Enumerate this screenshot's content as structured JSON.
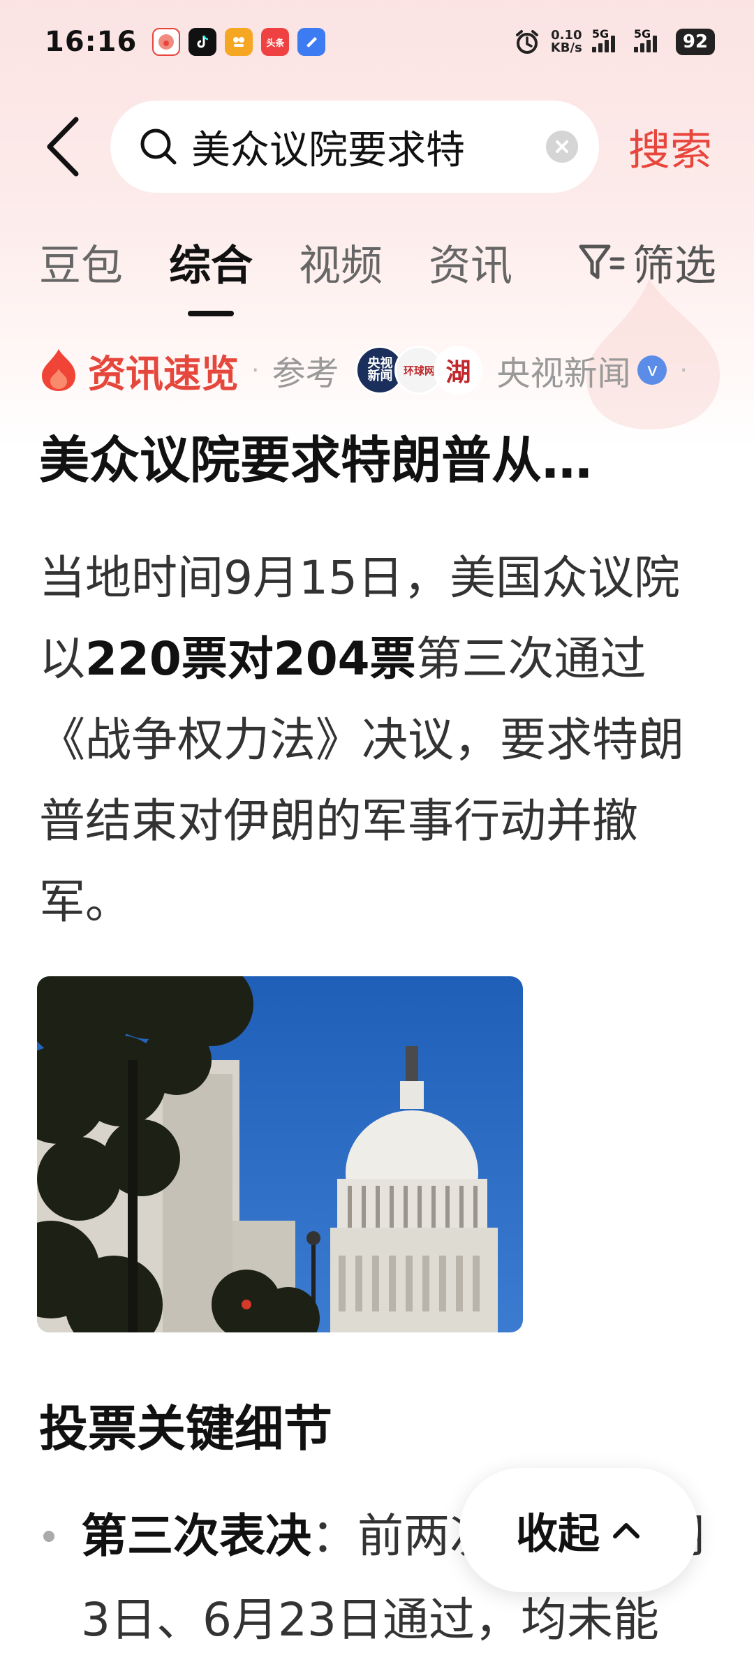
{
  "status_bar": {
    "time": "16:16",
    "net_speed_value": "0.10",
    "net_speed_unit": "KB/s",
    "signal_1": "5G",
    "signal_2": "5G",
    "battery": "92",
    "app_icons": [
      "clown-app-icon",
      "douyin-icon",
      "app-icon-orange",
      "toutiao-icon",
      "blue-app-icon"
    ],
    "toutiao_label": "头条"
  },
  "search": {
    "query": "美众议院要求特",
    "submit_label": "搜索"
  },
  "tabs": [
    {
      "label": "豆包",
      "active": false
    },
    {
      "label": "综合",
      "active": true
    },
    {
      "label": "视频",
      "active": false
    },
    {
      "label": "资讯",
      "active": false
    }
  ],
  "filter_label": "筛选",
  "quick_view": {
    "title": "资讯速览",
    "ref_label": "参考",
    "source_name": "央视新闻",
    "source_logos": [
      {
        "name": "cctv-news-logo",
        "text": "央视新闻"
      },
      {
        "name": "huanqiu-logo",
        "text": "环球网"
      },
      {
        "name": "hunan-logo",
        "text": "湖"
      }
    ]
  },
  "article": {
    "headline": "美众议院要求特朗普从…",
    "body_1": "当地时间9月15日，美国众议院以",
    "body_bold": "220票对204票",
    "body_2": "第三次通过《战争权力法》决议，要求特朗普结束对伊朗的军事行动并撤军。",
    "section_title": "投票关键细节",
    "bullet_bold": "第三次表决",
    "bullet_text": "：前两次分别在6月3日、6月23日通过，均未能"
  },
  "collapse_label": "收起",
  "colors": {
    "accent_red": "#e5473d",
    "search_red": "#e8453c",
    "verified_blue": "#5b8de8"
  }
}
